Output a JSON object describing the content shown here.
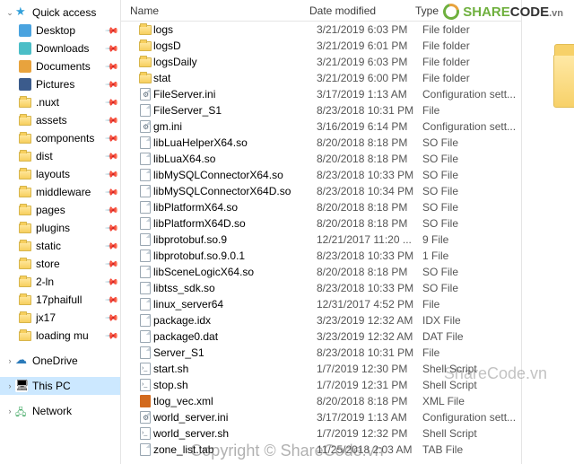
{
  "headers": {
    "name": "Name",
    "date": "Date modified",
    "type": "Type"
  },
  "sidebar": {
    "quick": "Quick access",
    "desktop": "Desktop",
    "downloads": "Downloads",
    "documents": "Documents",
    "pictures": "Pictures",
    "pinned": [
      ".nuxt",
      "assets",
      "components",
      "dist",
      "layouts",
      "middleware",
      "pages",
      "plugins",
      "static",
      "store",
      "2-ln",
      "17phaifull",
      "jx17",
      "loading mu"
    ],
    "onedrive": "OneDrive",
    "thispc": "This PC",
    "network": "Network"
  },
  "rows": [
    {
      "icon": "folder",
      "name": "logs",
      "date": "3/21/2019 6:03 PM",
      "type": "File folder"
    },
    {
      "icon": "folder",
      "name": "logsD",
      "date": "3/21/2019 6:01 PM",
      "type": "File folder"
    },
    {
      "icon": "folder",
      "name": "logsDaily",
      "date": "3/21/2019 6:03 PM",
      "type": "File folder"
    },
    {
      "icon": "folder",
      "name": "stat",
      "date": "3/21/2019 6:00 PM",
      "type": "File folder"
    },
    {
      "icon": "gear",
      "name": "FileServer.ini",
      "date": "3/17/2019 1:13 AM",
      "type": "Configuration sett..."
    },
    {
      "icon": "file",
      "name": "FileServer_S1",
      "date": "8/23/2018 10:31 PM",
      "type": "File"
    },
    {
      "icon": "gear",
      "name": "gm.ini",
      "date": "3/16/2019 6:14 PM",
      "type": "Configuration sett..."
    },
    {
      "icon": "file",
      "name": "libLuaHelperX64.so",
      "date": "8/20/2018 8:18 PM",
      "type": "SO File"
    },
    {
      "icon": "file",
      "name": "libLuaX64.so",
      "date": "8/20/2018 8:18 PM",
      "type": "SO File"
    },
    {
      "icon": "file",
      "name": "libMySQLConnectorX64.so",
      "date": "8/23/2018 10:33 PM",
      "type": "SO File"
    },
    {
      "icon": "file",
      "name": "libMySQLConnectorX64D.so",
      "date": "8/23/2018 10:34 PM",
      "type": "SO File"
    },
    {
      "icon": "file",
      "name": "libPlatformX64.so",
      "date": "8/20/2018 8:18 PM",
      "type": "SO File"
    },
    {
      "icon": "file",
      "name": "libPlatformX64D.so",
      "date": "8/20/2018 8:18 PM",
      "type": "SO File"
    },
    {
      "icon": "file",
      "name": "libprotobuf.so.9",
      "date": "12/21/2017 11:20 ...",
      "type": "9 File"
    },
    {
      "icon": "file",
      "name": "libprotobuf.so.9.0.1",
      "date": "8/23/2018 10:33 PM",
      "type": "1 File"
    },
    {
      "icon": "file",
      "name": "libSceneLogicX64.so",
      "date": "8/20/2018 8:18 PM",
      "type": "SO File"
    },
    {
      "icon": "file",
      "name": "libtss_sdk.so",
      "date": "8/23/2018 10:33 PM",
      "type": "SO File"
    },
    {
      "icon": "file",
      "name": "linux_server64",
      "date": "12/31/2017 4:52 PM",
      "type": "File"
    },
    {
      "icon": "file",
      "name": "package.idx",
      "date": "3/23/2019 12:32 AM",
      "type": "IDX File"
    },
    {
      "icon": "file",
      "name": "package0.dat",
      "date": "3/23/2019 12:32 AM",
      "type": "DAT File"
    },
    {
      "icon": "file",
      "name": "Server_S1",
      "date": "8/23/2018 10:31 PM",
      "type": "File"
    },
    {
      "icon": "sh",
      "name": "start.sh",
      "date": "1/7/2019 12:30 PM",
      "type": "Shell Script"
    },
    {
      "icon": "sh",
      "name": "stop.sh",
      "date": "1/7/2019 12:31 PM",
      "type": "Shell Script"
    },
    {
      "icon": "xml",
      "name": "tlog_vec.xml",
      "date": "8/20/2018 8:18 PM",
      "type": "XML File"
    },
    {
      "icon": "gear",
      "name": "world_server.ini",
      "date": "3/17/2019 1:13 AM",
      "type": "Configuration sett..."
    },
    {
      "icon": "sh",
      "name": "world_server.sh",
      "date": "1/7/2019 12:32 PM",
      "type": "Shell Script"
    },
    {
      "icon": "file",
      "name": "zone_list.tab",
      "date": "11/25/2018 2:03 AM",
      "type": "TAB File"
    }
  ],
  "watermark": {
    "brand_share": "SHARE",
    "brand_code": "CODE",
    "brand_tld": ".vn",
    "text": "ShareCode.vn",
    "copyright": "Copyright © ShareCode.vn"
  }
}
